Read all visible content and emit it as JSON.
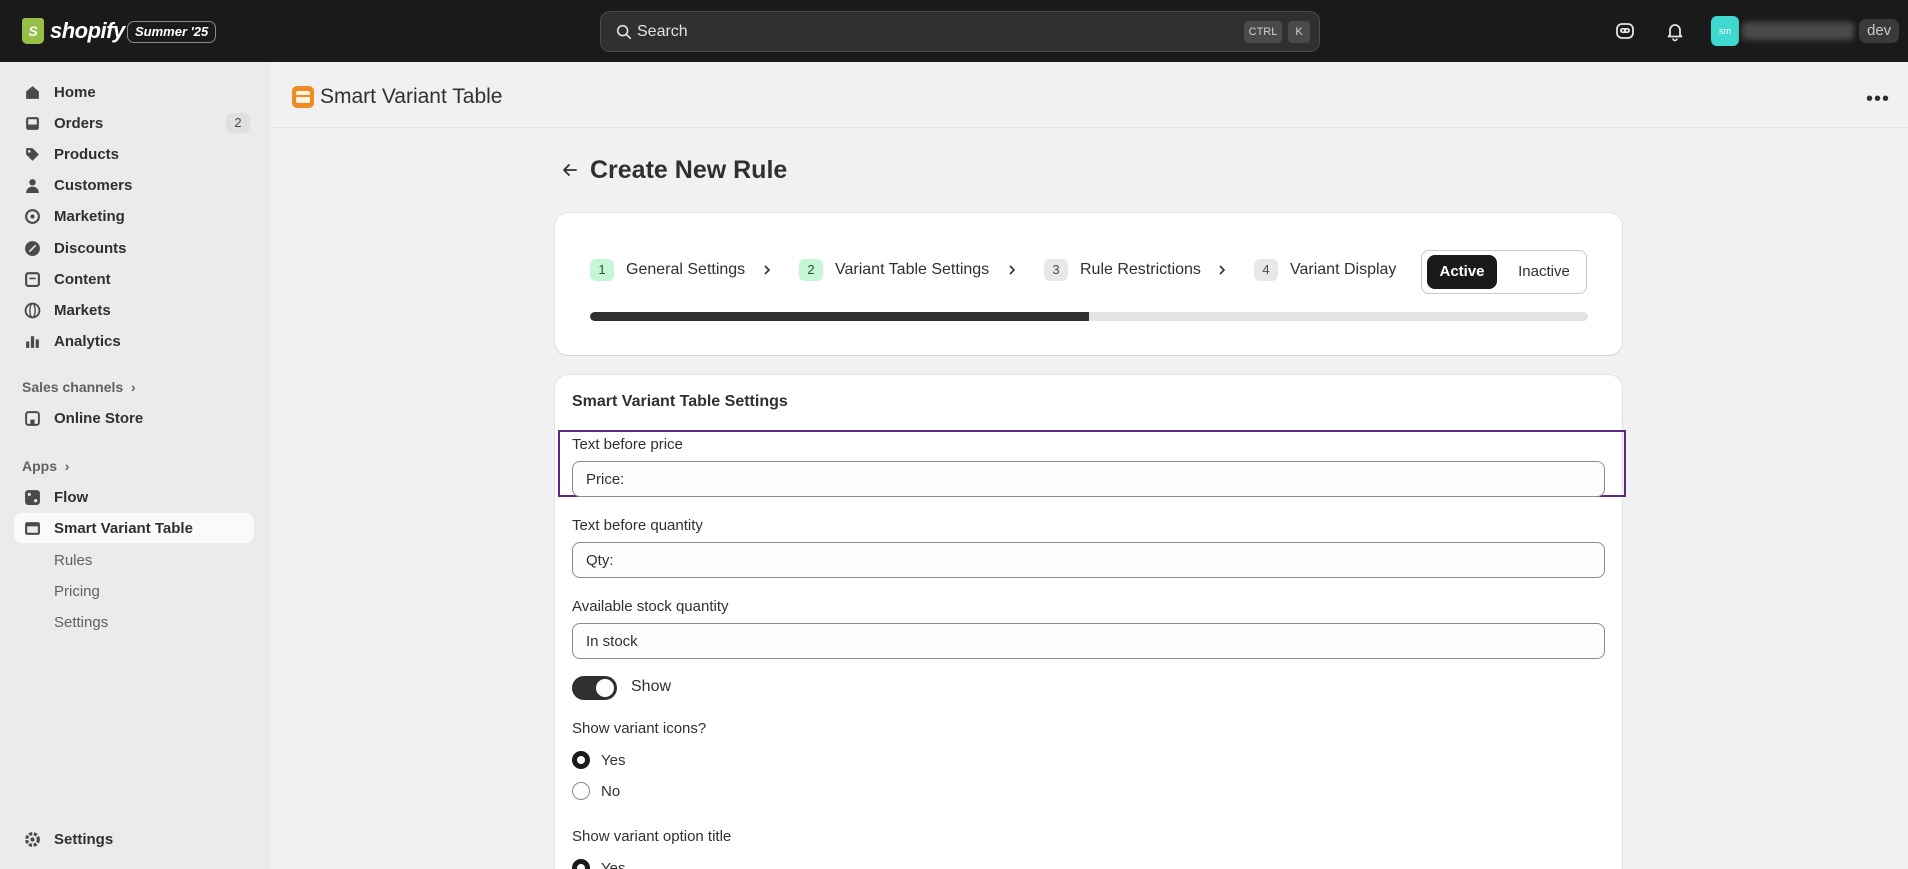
{
  "topbar": {
    "logo_text": "shopify",
    "edition_badge": "Summer '25",
    "search_placeholder": "Search",
    "shortcut_ctrl": "CTRL",
    "shortcut_key": "K",
    "avatar_initials": "sm",
    "dev_badge": "dev"
  },
  "sidebar": {
    "items": [
      {
        "label": "Home",
        "icon": "home-icon"
      },
      {
        "label": "Orders",
        "icon": "inbox-icon",
        "count": "2"
      },
      {
        "label": "Products",
        "icon": "tag-icon"
      },
      {
        "label": "Customers",
        "icon": "person-icon"
      },
      {
        "label": "Marketing",
        "icon": "target-icon"
      },
      {
        "label": "Discounts",
        "icon": "discount-icon"
      },
      {
        "label": "Content",
        "icon": "content-icon"
      },
      {
        "label": "Markets",
        "icon": "globe-icon"
      },
      {
        "label": "Analytics",
        "icon": "bar-chart-icon"
      }
    ],
    "sales_channels_label": "Sales channels",
    "online_store_label": "Online Store",
    "apps_label": "Apps",
    "flow_label": "Flow",
    "app_label": "Smart Variant Table",
    "sub_items": [
      "Rules",
      "Pricing",
      "Settings"
    ],
    "settings_label": "Settings"
  },
  "header": {
    "title": "Smart Variant Table"
  },
  "page": {
    "title": "Create New Rule"
  },
  "steps": {
    "items": [
      {
        "num": "1",
        "label": "General Settings",
        "done": true
      },
      {
        "num": "2",
        "label": "Variant Table Settings",
        "done": true
      },
      {
        "num": "3",
        "label": "Rule Restrictions",
        "done": false
      },
      {
        "num": "4",
        "label": "Variant Display",
        "done": false
      }
    ],
    "active_label": "Active",
    "inactive_label": "Inactive",
    "progress_fraction": 0.5
  },
  "settings": {
    "title": "Smart Variant Table Settings",
    "fields": [
      {
        "label": "Text before price",
        "value": "Price:"
      },
      {
        "label": "Text before quantity",
        "value": "Qty:"
      },
      {
        "label": "Available stock quantity",
        "value": "In stock"
      }
    ],
    "toggle_label": "Show",
    "variant_icons_label": "Show variant icons?",
    "yes_label": "Yes",
    "no_label": "No",
    "option_title_label": "Show variant option title"
  },
  "colors": {
    "topbar": "#1a1a1a",
    "highlight": "#5b2a86",
    "step_done": "#c6f6d5",
    "avatar": "#3fd9d0"
  }
}
